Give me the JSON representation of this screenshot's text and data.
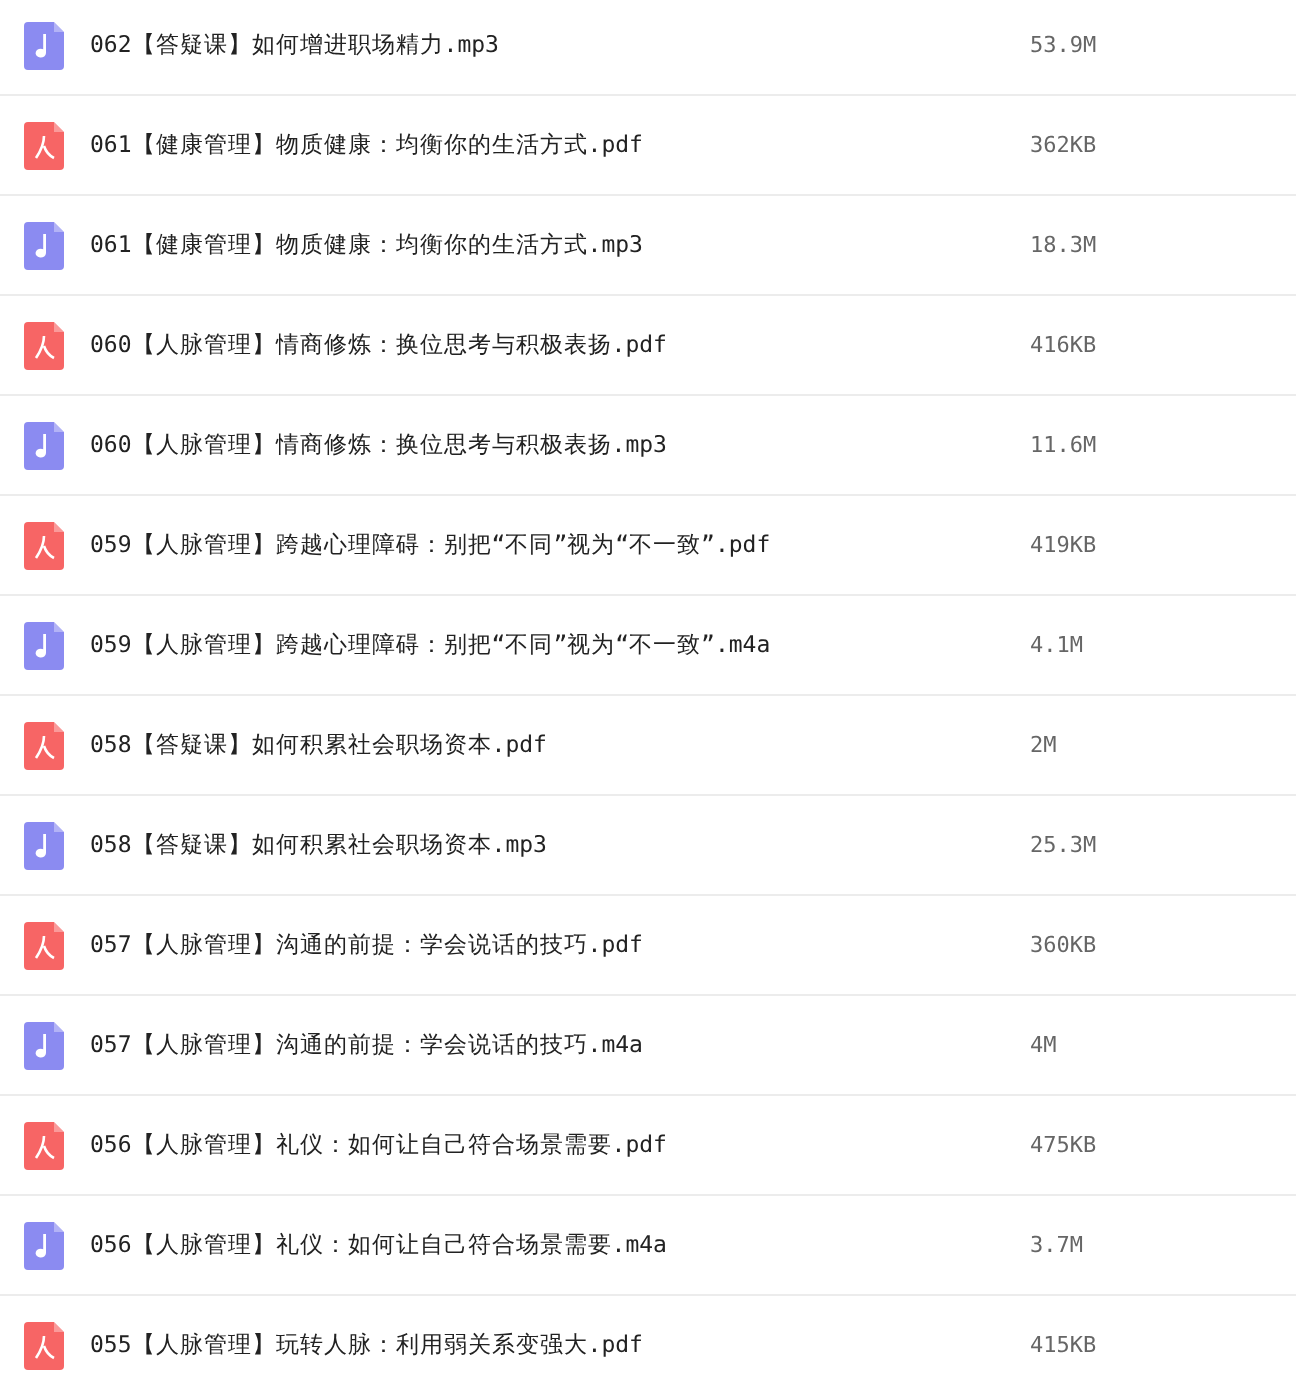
{
  "files": [
    {
      "kind": "audio",
      "name": "062【答疑课】如何增进职场精力.mp3",
      "size": "53.9M"
    },
    {
      "kind": "pdf",
      "name": "061【健康管理】物质健康：均衡你的生活方式.pdf",
      "size": "362KB"
    },
    {
      "kind": "audio",
      "name": "061【健康管理】物质健康：均衡你的生活方式.mp3",
      "size": "18.3M"
    },
    {
      "kind": "pdf",
      "name": "060【人脉管理】情商修炼：换位思考与积极表扬.pdf",
      "size": "416KB"
    },
    {
      "kind": "audio",
      "name": "060【人脉管理】情商修炼：换位思考与积极表扬.mp3",
      "size": "11.6M"
    },
    {
      "kind": "pdf",
      "name": "059【人脉管理】跨越心理障碍：别把“不同”视为“不一致”.pdf",
      "size": "419KB"
    },
    {
      "kind": "audio",
      "name": "059【人脉管理】跨越心理障碍：别把“不同”视为“不一致”.m4a",
      "size": "4.1M"
    },
    {
      "kind": "pdf",
      "name": "058【答疑课】如何积累社会职场资本.pdf",
      "size": "2M"
    },
    {
      "kind": "audio",
      "name": "058【答疑课】如何积累社会职场资本.mp3",
      "size": "25.3M"
    },
    {
      "kind": "pdf",
      "name": "057【人脉管理】沟通的前提：学会说话的技巧.pdf",
      "size": "360KB"
    },
    {
      "kind": "audio",
      "name": "057【人脉管理】沟通的前提：学会说话的技巧.m4a",
      "size": "4M"
    },
    {
      "kind": "pdf",
      "name": "056【人脉管理】礼仪：如何让自己符合场景需要.pdf",
      "size": "475KB"
    },
    {
      "kind": "audio",
      "name": "056【人脉管理】礼仪：如何让自己符合场景需要.m4a",
      "size": "3.7M"
    },
    {
      "kind": "pdf",
      "name": "055【人脉管理】玩转人脉：利用弱关系变强大.pdf",
      "size": "415KB"
    }
  ]
}
